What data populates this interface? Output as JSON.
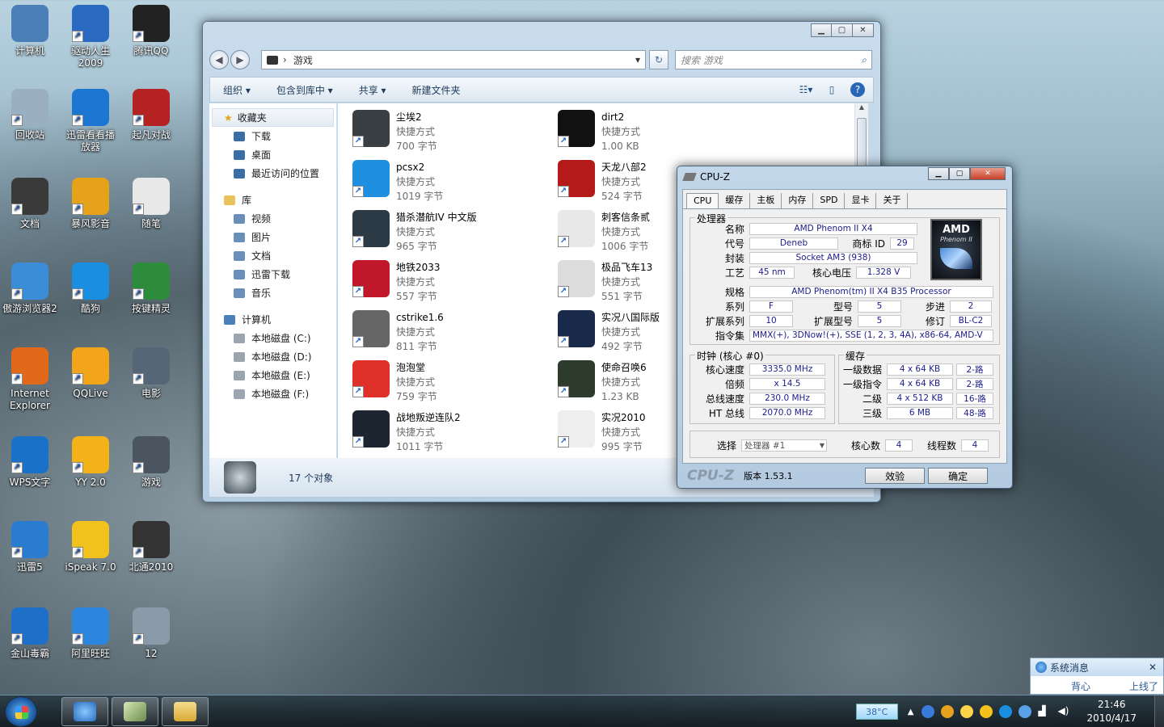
{
  "desktop_icons": [
    {
      "label": "计算机",
      "icon": "computer-icon",
      "color": "#4b7fb8"
    },
    {
      "label": "驱动人生\n2009",
      "icon": "driver-life-icon",
      "color": "#2a6ac0"
    },
    {
      "label": "腾讯QQ",
      "icon": "qq-penguin-icon",
      "color": "#222222"
    },
    {
      "label": "回收站",
      "icon": "recycle-bin-icon",
      "color": "#9ab0c2"
    },
    {
      "label": "迅雷看看播\n放器",
      "icon": "xunlei-player-icon",
      "color": "#1b77d2"
    },
    {
      "label": "起凡对战",
      "icon": "qifan-icon",
      "color": "#b42222"
    },
    {
      "label": "文档",
      "icon": "document-icon",
      "color": "#3a3a3a"
    },
    {
      "label": "暴风影音",
      "icon": "baofeng-icon",
      "color": "#e6a21a"
    },
    {
      "label": "随笔",
      "icon": "notepad-icon",
      "color": "#e8e8e8"
    },
    {
      "label": "傲游浏览器2",
      "icon": "maxthon-icon",
      "color": "#3b8dd8"
    },
    {
      "label": "酷狗",
      "icon": "kugou-icon",
      "color": "#1a8ee0"
    },
    {
      "label": "按键精灵",
      "icon": "keyboard-wizard-icon",
      "color": "#2c8c3c"
    },
    {
      "label": "Internet\nExplorer",
      "icon": "firefox-icon",
      "color": "#e06a1a"
    },
    {
      "label": "QQLive",
      "icon": "qqlive-icon",
      "color": "#f2a518"
    },
    {
      "label": "电影",
      "icon": "movie-icon",
      "color": "#556677"
    },
    {
      "label": "WPS文字",
      "icon": "wps-icon",
      "color": "#1a72c8"
    },
    {
      "label": "YY 2.0",
      "icon": "yy-icon",
      "color": "#f2b218"
    },
    {
      "label": "游戏",
      "icon": "games-folder-icon",
      "color": "#4a5560"
    },
    {
      "label": "迅雷5",
      "icon": "xunlei5-icon",
      "color": "#2a7cd0"
    },
    {
      "label": "iSpeak 7.0",
      "icon": "ispeak-icon",
      "color": "#f1c21b"
    },
    {
      "label": "北通2010",
      "icon": "betop-icon",
      "color": "#333333"
    },
    {
      "label": "金山毒霸",
      "icon": "kingsoft-av-icon",
      "color": "#1e6fc8"
    },
    {
      "label": "阿里旺旺",
      "icon": "aliwangwang-icon",
      "color": "#2b86e0"
    },
    {
      "label": "12",
      "icon": "photo-thumbnail-icon",
      "color": "#8a9aa8"
    }
  ],
  "explorer": {
    "path": "游戏",
    "search_placeholder": "搜索 游戏",
    "toolbar": {
      "organize": "组织 ▾",
      "include_library": "包含到库中 ▾",
      "share": "共享 ▾",
      "new_folder": "新建文件夹"
    },
    "nav": {
      "favorites": "收藏夹",
      "favorites_items": [
        "下载",
        "桌面",
        "最近访问的位置"
      ],
      "libraries": "库",
      "library_items": [
        "视频",
        "图片",
        "文档",
        "迅雷下载",
        "音乐"
      ],
      "computer": "计算机",
      "drives": [
        "本地磁盘 (C:)",
        "本地磁盘 (D:)",
        "本地磁盘 (E:)",
        "本地磁盘 (F:)"
      ]
    },
    "files": [
      {
        "name": "尘埃2",
        "type": "快捷方式",
        "size": "700 字节",
        "color": "#3a3f44"
      },
      {
        "name": "dirt2",
        "type": "快捷方式",
        "size": "1.00 KB",
        "color": "#111111"
      },
      {
        "name": "pcsx2",
        "type": "快捷方式",
        "size": "1019 字节",
        "color": "#1f8fe0"
      },
      {
        "name": "天龙八部2",
        "type": "快捷方式",
        "size": "524 字节",
        "color": "#b51a1a"
      },
      {
        "name": "猎杀潜航IV 中文版",
        "type": "快捷方式",
        "size": "965 字节",
        "color": "#2b3a44"
      },
      {
        "name": "刺客信条贰",
        "type": "快捷方式",
        "size": "1006 字节",
        "color": "#e8e8e8"
      },
      {
        "name": "地铁2033",
        "type": "快捷方式",
        "size": "557 字节",
        "color": "#c0182a"
      },
      {
        "name": "极品飞车13",
        "type": "快捷方式",
        "size": "551 字节",
        "color": "#dddddd"
      },
      {
        "name": "cstrike1.6",
        "type": "快捷方式",
        "size": "811 字节",
        "color": "#666666"
      },
      {
        "name": "实况八国际版",
        "type": "快捷方式",
        "size": "492 字节",
        "color": "#1a2a4a"
      },
      {
        "name": "泡泡堂",
        "type": "快捷方式",
        "size": "759 字节",
        "color": "#e0302a"
      },
      {
        "name": "使命召唤6",
        "type": "快捷方式",
        "size": "1.23 KB",
        "color": "#2c3b2c"
      },
      {
        "name": "战地叛逆连队2",
        "type": "快捷方式",
        "size": "1011 字节",
        "color": "#1d2630"
      },
      {
        "name": "实况2010",
        "type": "快捷方式",
        "size": "995 字节",
        "color": "#eeeeee"
      }
    ],
    "status": "17 个对象"
  },
  "cpuz": {
    "title": "CPU-Z",
    "tabs": [
      "CPU",
      "缓存",
      "主板",
      "内存",
      "SPD",
      "显卡",
      "关于"
    ],
    "processor_group": "处理器",
    "name_label": "名称",
    "name": "AMD Phenom II X4",
    "codename_label": "代号",
    "codename": "Deneb",
    "brand_id_label": "商标 ID",
    "brand_id": "29",
    "package_label": "封装",
    "package": "Socket AM3 (938)",
    "tech_label": "工艺",
    "tech": "45 nm",
    "voltage_label": "核心电压",
    "voltage": "1.328 V",
    "spec_label": "规格",
    "spec": "AMD Phenom(tm) II X4 B35 Processor",
    "family_label": "系列",
    "family": "F",
    "model_label": "型号",
    "model": "5",
    "stepping_label": "步进",
    "stepping": "2",
    "ext_family_label": "扩展系列",
    "ext_family": "10",
    "ext_model_label": "扩展型号",
    "ext_model": "5",
    "revision_label": "修订",
    "revision": "BL-C2",
    "instructions_label": "指令集",
    "instructions": "MMX(+), 3DNow!(+), SSE (1, 2, 3, 4A), x86-64, AMD-V",
    "clocks_group": "时钟 (核心 #0)",
    "core_speed_label": "核心速度",
    "core_speed": "3335.0 MHz",
    "multiplier_label": "倍频",
    "multiplier": "x 14.5",
    "bus_speed_label": "总线速度",
    "bus_speed": "230.0 MHz",
    "ht_label": "HT 总线",
    "ht": "2070.0 MHz",
    "cache_group": "缓存",
    "l1d_label": "一级数据",
    "l1d": "4 x 64 KB",
    "l1d_way": "2-路",
    "l1i_label": "一级指令",
    "l1i": "4 x 64 KB",
    "l1i_way": "2-路",
    "l2_label": "二级",
    "l2": "4 x 512 KB",
    "l2_way": "16-路",
    "l3_label": "三级",
    "l3": "6 MB",
    "l3_way": "48-路",
    "select_label": "选择",
    "select_value": "处理器 #1",
    "cores_label": "核心数",
    "cores": "4",
    "threads_label": "线程数",
    "threads": "4",
    "brand_text": "CPU-Z",
    "version": "版本 1.53.1",
    "validate": "效验",
    "ok": "确定",
    "logo_text": "AMD",
    "logo_sub": "Phenom II"
  },
  "taskbar": {
    "temperature": "38°C",
    "time": "21:46",
    "date": "2010/4/17"
  },
  "sysmsg": {
    "title": "系统消息",
    "left": "背心",
    "right": "上线了"
  }
}
